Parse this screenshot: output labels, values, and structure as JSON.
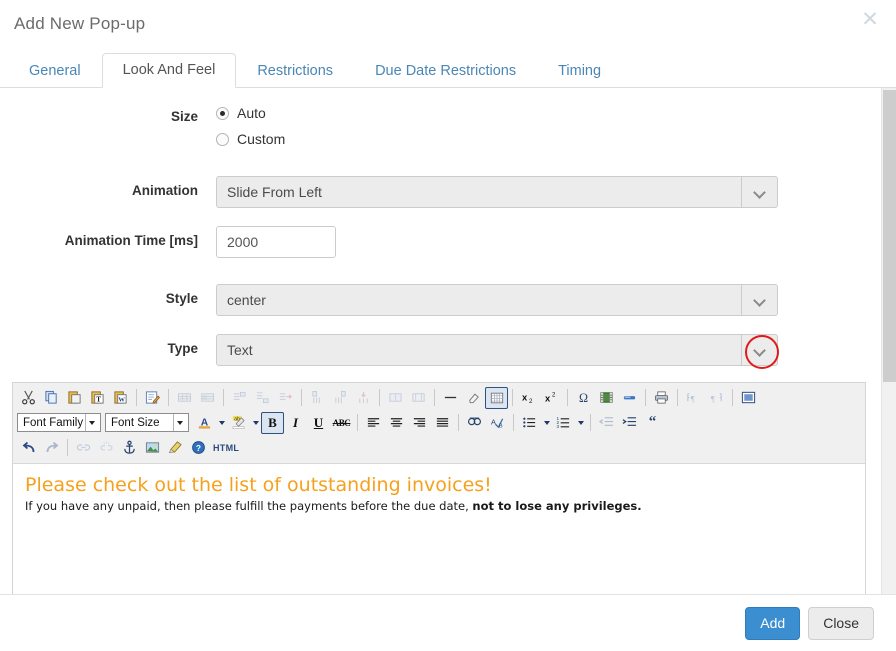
{
  "modal": {
    "title": "Add New Pop-up",
    "close_icon": "close-icon"
  },
  "tabs": [
    {
      "label": "General",
      "active": false
    },
    {
      "label": "Look And Feel",
      "active": true
    },
    {
      "label": "Restrictions",
      "active": false
    },
    {
      "label": "Due Date Restrictions",
      "active": false
    },
    {
      "label": "Timing",
      "active": false
    }
  ],
  "form": {
    "size": {
      "label": "Size",
      "options": [
        {
          "label": "Auto",
          "selected": true
        },
        {
          "label": "Custom",
          "selected": false
        }
      ]
    },
    "animation": {
      "label": "Animation",
      "value": "Slide From Left"
    },
    "animation_time": {
      "label": "Animation Time [ms]",
      "value": "2000",
      "placeholder": "2000"
    },
    "style": {
      "label": "Style",
      "value": "center"
    },
    "type": {
      "label": "Type",
      "value": "Text",
      "highlighted": true
    }
  },
  "editor": {
    "toolbar_row1": [
      {
        "name": "cut-icon",
        "title": "Cut"
      },
      {
        "name": "copy-icon",
        "title": "Copy"
      },
      {
        "name": "paste-icon",
        "title": "Paste"
      },
      {
        "name": "paste-text-icon",
        "title": "Paste as plain text"
      },
      {
        "name": "paste-word-icon",
        "title": "Paste from Word"
      },
      {
        "sep": true
      },
      {
        "name": "edit-source-icon",
        "title": "Edit source"
      },
      {
        "sep": true
      },
      {
        "name": "table-insert-icon",
        "title": "Insert table",
        "dim": true
      },
      {
        "name": "table-properties-icon",
        "title": "Table properties",
        "dim": true
      },
      {
        "sep": true
      },
      {
        "name": "row-insert-before-icon",
        "title": "Insert row before",
        "dim": true
      },
      {
        "name": "row-insert-after-icon",
        "title": "Insert row after",
        "dim": true
      },
      {
        "name": "row-delete-icon",
        "title": "Delete row",
        "dim": true
      },
      {
        "sep": true
      },
      {
        "name": "column-insert-before-icon",
        "title": "Insert column before",
        "dim": true
      },
      {
        "name": "column-insert-after-icon",
        "title": "Insert column after",
        "dim": true
      },
      {
        "name": "column-delete-icon",
        "title": "Delete column",
        "dim": true
      },
      {
        "sep": true
      },
      {
        "name": "merge-cells-icon",
        "title": "Merge cells",
        "dim": true
      },
      {
        "name": "split-cell-icon",
        "title": "Split cell",
        "dim": true
      },
      {
        "sep": true
      },
      {
        "name": "horizontal-rule-icon",
        "title": "Horizontal rule"
      },
      {
        "name": "erase-formatting-icon",
        "title": "Remove formatting"
      },
      {
        "name": "grid-toggle-icon",
        "title": "Toggle guidelines",
        "pressed": true
      },
      {
        "sep": true
      },
      {
        "name": "subscript-icon",
        "title": "Subscript"
      },
      {
        "name": "superscript-icon",
        "title": "Superscript"
      },
      {
        "sep": true
      },
      {
        "name": "special-character-icon",
        "title": "Insert special character"
      },
      {
        "name": "media-icon",
        "title": "Insert media"
      },
      {
        "name": "page-break-icon",
        "title": "Insert page break"
      },
      {
        "sep": true
      },
      {
        "name": "print-icon",
        "title": "Print"
      },
      {
        "sep": true
      },
      {
        "name": "ltr-icon",
        "title": "Left to right",
        "dim": true
      },
      {
        "name": "rtl-icon",
        "title": "Right to left",
        "dim": true
      },
      {
        "sep": true
      },
      {
        "name": "fullscreen-icon",
        "title": "Fullscreen"
      }
    ],
    "font_family": {
      "label": "Font Family"
    },
    "font_size": {
      "label": "Font Size"
    },
    "toolbar_row2": [
      {
        "name": "text-color-icon",
        "title": "Text color",
        "caret": true
      },
      {
        "name": "background-color-icon",
        "title": "Background color",
        "caret": true
      },
      {
        "name": "bold-icon",
        "title": "Bold",
        "glyph": "B",
        "pressed": true
      },
      {
        "name": "italic-icon",
        "title": "Italic",
        "glyph": "I"
      },
      {
        "name": "underline-icon",
        "title": "Underline",
        "glyph": "U"
      },
      {
        "name": "strikethrough-icon",
        "title": "Strikethrough",
        "glyph": "ABC"
      },
      {
        "sep": true
      },
      {
        "name": "align-left-icon",
        "title": "Align left"
      },
      {
        "name": "align-center-icon",
        "title": "Align center"
      },
      {
        "name": "align-right-icon",
        "title": "Align right"
      },
      {
        "name": "align-justify-icon",
        "title": "Justify"
      },
      {
        "sep": true
      },
      {
        "name": "find-replace-icon",
        "title": "Find and replace"
      },
      {
        "name": "spellcheck-icon",
        "title": "Spell check"
      },
      {
        "sep": true
      },
      {
        "name": "bullet-list-icon",
        "title": "Bulleted list",
        "caret": true
      },
      {
        "name": "numbered-list-icon",
        "title": "Numbered list",
        "caret": true
      },
      {
        "sep": true
      },
      {
        "name": "outdent-icon",
        "title": "Decrease indent",
        "dim": true
      },
      {
        "name": "indent-icon",
        "title": "Increase indent"
      },
      {
        "name": "blockquote-icon",
        "title": "Blockquote"
      }
    ],
    "toolbar_row3": [
      {
        "name": "undo-icon",
        "title": "Undo"
      },
      {
        "name": "redo-icon",
        "title": "Redo",
        "dim": true
      },
      {
        "sep": true
      },
      {
        "name": "link-icon",
        "title": "Insert link",
        "dim": true
      },
      {
        "name": "unlink-icon",
        "title": "Remove link",
        "dim": true
      },
      {
        "name": "anchor-icon",
        "title": "Insert anchor"
      },
      {
        "name": "image-icon",
        "title": "Insert image"
      },
      {
        "name": "cleanup-icon",
        "title": "Clean up messy code"
      },
      {
        "name": "help-icon",
        "title": "Help"
      },
      {
        "name": "html-icon",
        "title": "HTML",
        "label": "HTML"
      }
    ],
    "content": {
      "heading": "Please check out the list of outstanding invoices!",
      "paragraph_prefix": "If you have any unpaid, then please fulfill the payments before the due date, ",
      "paragraph_bold": "not to lose any privileges."
    }
  },
  "footer": {
    "add_label": "Add",
    "close_label": "Close"
  },
  "colors": {
    "accent_blue": "#3b8ed0",
    "tab_link": "#4a87b5",
    "heading_orange": "#f5a11e",
    "highlight_red": "#e01a1a"
  }
}
